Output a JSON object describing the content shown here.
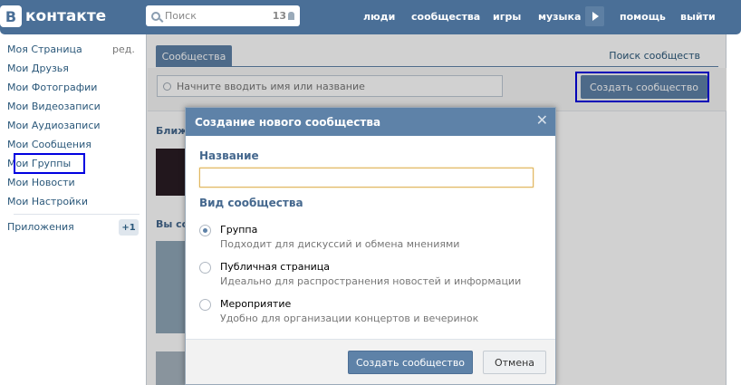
{
  "header": {
    "logo_letter": "В",
    "logo_text": "контакте",
    "search_placeholder": "Поиск",
    "search_count": "13",
    "nav": [
      "люди",
      "сообщества",
      "игры",
      "музыка",
      "помощь",
      "выйти"
    ]
  },
  "sidebar": {
    "items": [
      {
        "label": "Моя Страница",
        "extra": "ред."
      },
      {
        "label": "Мои Друзья"
      },
      {
        "label": "Мои Фотографии"
      },
      {
        "label": "Мои Видеозаписи"
      },
      {
        "label": "Мои Аудиозаписи"
      },
      {
        "label": "Мои Сообщения"
      },
      {
        "label": "Мои Группы"
      },
      {
        "label": "Мои Новости"
      },
      {
        "label": "Мои Настройки"
      }
    ],
    "apps_label": "Приложения",
    "apps_badge": "+1"
  },
  "main": {
    "tab_label": "Сообщества",
    "search_communities": "Поиск сообществ",
    "filter_placeholder": "Начните вводить имя или название",
    "create_button": "Создать сообщество",
    "section_nearby": "Ближ",
    "section_you": "Вы со"
  },
  "modal": {
    "title": "Создание нового сообщества",
    "close": "✕",
    "name_label": "Название",
    "name_value": "",
    "type_label": "Вид сообщества",
    "options": [
      {
        "title": "Группа",
        "desc": "Подходит для дискуссий и обмена мнениями",
        "selected": true
      },
      {
        "title": "Публичная страница",
        "desc": "Идеально для распространения новостей и информации",
        "selected": false
      },
      {
        "title": "Мероприятие",
        "desc": "Удобно для организации концертов и вечеринок",
        "selected": false
      }
    ],
    "submit": "Создать сообщество",
    "cancel": "Отмена"
  },
  "colors": {
    "brand": "#4a6f97",
    "button": "#5e82a8",
    "link": "#2b587a",
    "highlight": "#0000e0"
  }
}
